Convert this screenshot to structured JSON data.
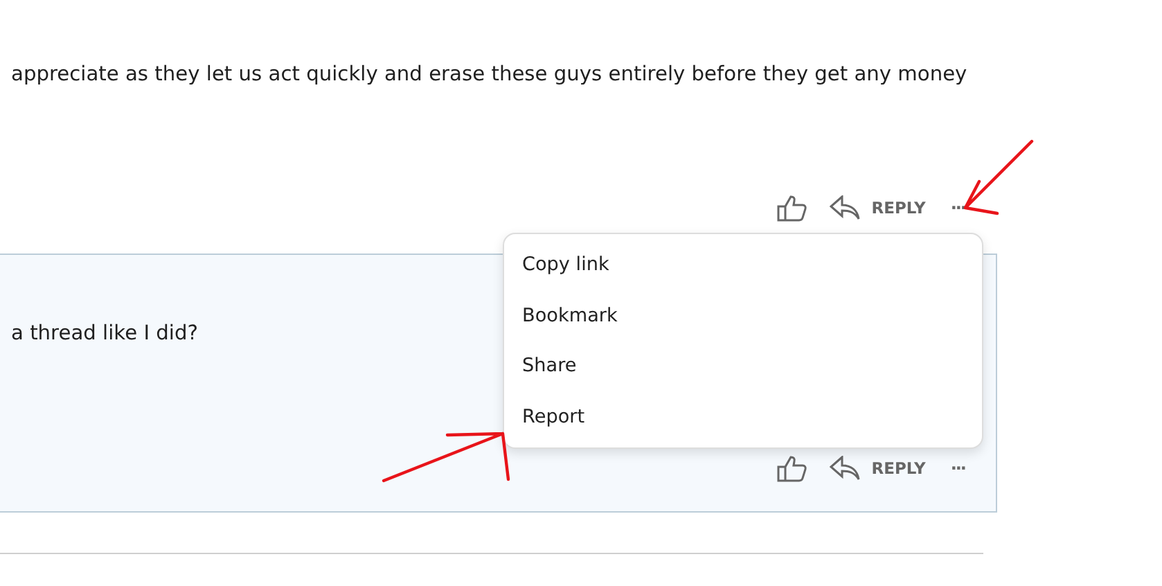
{
  "comments": [
    {
      "text": "appreciate as they let us act quickly and erase these guys entirely before they get any money",
      "highlighted": false,
      "actions": {
        "reply": "REPLY",
        "more": "···"
      }
    },
    {
      "text": "a thread like I did?",
      "highlighted": true,
      "actions": {
        "reply": "REPLY",
        "more": "···"
      }
    }
  ],
  "menu": {
    "items": [
      "Copy link",
      "Bookmark",
      "Share",
      "Report"
    ]
  }
}
